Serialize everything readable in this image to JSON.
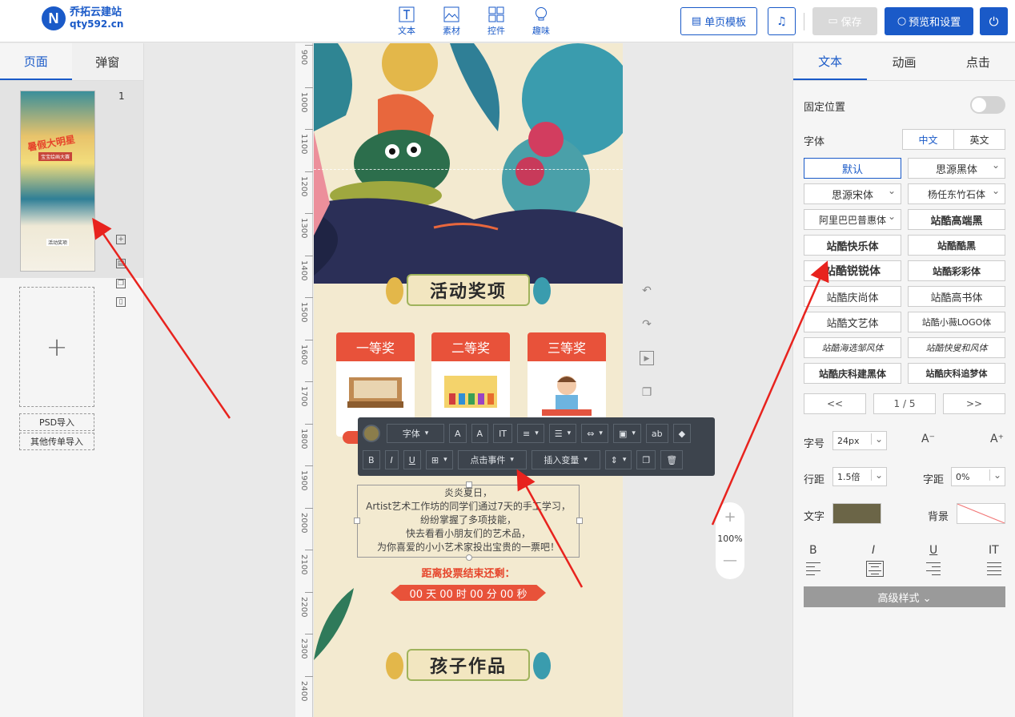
{
  "app": {
    "logo_mark": "N",
    "logo_line1": "乔拓云建站",
    "logo_line2": "qty592.cn"
  },
  "toolbar": {
    "tools": [
      {
        "label": "文本",
        "icon": "text-icon"
      },
      {
        "label": "素材",
        "icon": "image-icon"
      },
      {
        "label": "控件",
        "icon": "widgets-icon"
      },
      {
        "label": "趣味",
        "icon": "bulb-icon"
      }
    ],
    "template_label": "单页模板",
    "music_icon": "music-icon",
    "save_label": "保存",
    "preview_label": "预览和设置",
    "power_icon": "power-icon"
  },
  "left_panel": {
    "tabs": [
      "页面",
      "弹窗"
    ],
    "active_tab": 0,
    "page_number": "1",
    "thumb_title": "暑假大明星",
    "thumb_sub": "宝宝绘画大赛",
    "thumb_section": "活动奖项",
    "import_psd": "PSD导入",
    "import_other": "其他传单导入"
  },
  "ruler": {
    "ticks": [
      "900",
      "1000",
      "1100",
      "1200",
      "1300",
      "1400",
      "1500",
      "1600",
      "1700",
      "1800",
      "1900",
      "2000",
      "2100",
      "2200",
      "2300",
      "2400",
      "2"
    ]
  },
  "canvas": {
    "section_title_1": "活动奖项",
    "prizes": [
      "一等奖",
      "二等奖",
      "三等奖"
    ],
    "text_lines": [
      "炎炎夏日，",
      "Artist艺术工作坊的同学们通过7天的手工学习，",
      "纷纷掌握了多项技能，",
      "快去看看小朋友们的艺术品，",
      "为你喜爱的小小艺术家投出宝贵的一票吧！"
    ],
    "countdown_title": "距离投票结束还剩：",
    "countdown": "00 天 00 时 00 分 00 秒",
    "section_title_2": "孩子作品"
  },
  "float_toolbar": {
    "font_label": "字体",
    "click_event": "点击事件",
    "insert_var": "插入变量",
    "text_color": "#8b7d4b"
  },
  "zoom": {
    "plus": "+",
    "value": "100%",
    "minus": "—"
  },
  "right_panel": {
    "tabs": [
      "文本",
      "动画",
      "点击"
    ],
    "active_tab": 0,
    "fixed_position": "固定位置",
    "font_label": "字体",
    "lang": [
      "中文",
      "英文"
    ],
    "fonts": [
      "默认",
      "思源黑体",
      "思源宋体",
      "杨任东竹石体",
      "阿里巴巴普惠体",
      "站酷高端黑",
      "站酷快乐体",
      "站酷酷黑",
      "站酷锐锐体",
      "站酷彩彩体",
      "站酷庆尚体",
      "站酷高书体",
      "站酷文艺体",
      "站酷小薇LOGO体",
      "站酷海选邹风体",
      "站酷快叟和风体",
      "站酷庆科建黑体",
      "站酷庆科追梦体"
    ],
    "pager_prev": "<<",
    "pager_value": "1 / 5",
    "pager_next": ">>",
    "size_label": "字号",
    "size_value": "24px",
    "size_down": "A⁻",
    "size_up": "A⁺",
    "line_label": "行距",
    "line_value": "1.5倍",
    "spacing_label": "字距",
    "spacing_value": "0%",
    "text_color_label": "文字",
    "text_color": "#6b6547",
    "bg_label": "背景",
    "bold": "B",
    "italic": "I",
    "underline": "U",
    "vertical": "IT",
    "advanced": "高级样式 ⌄"
  }
}
